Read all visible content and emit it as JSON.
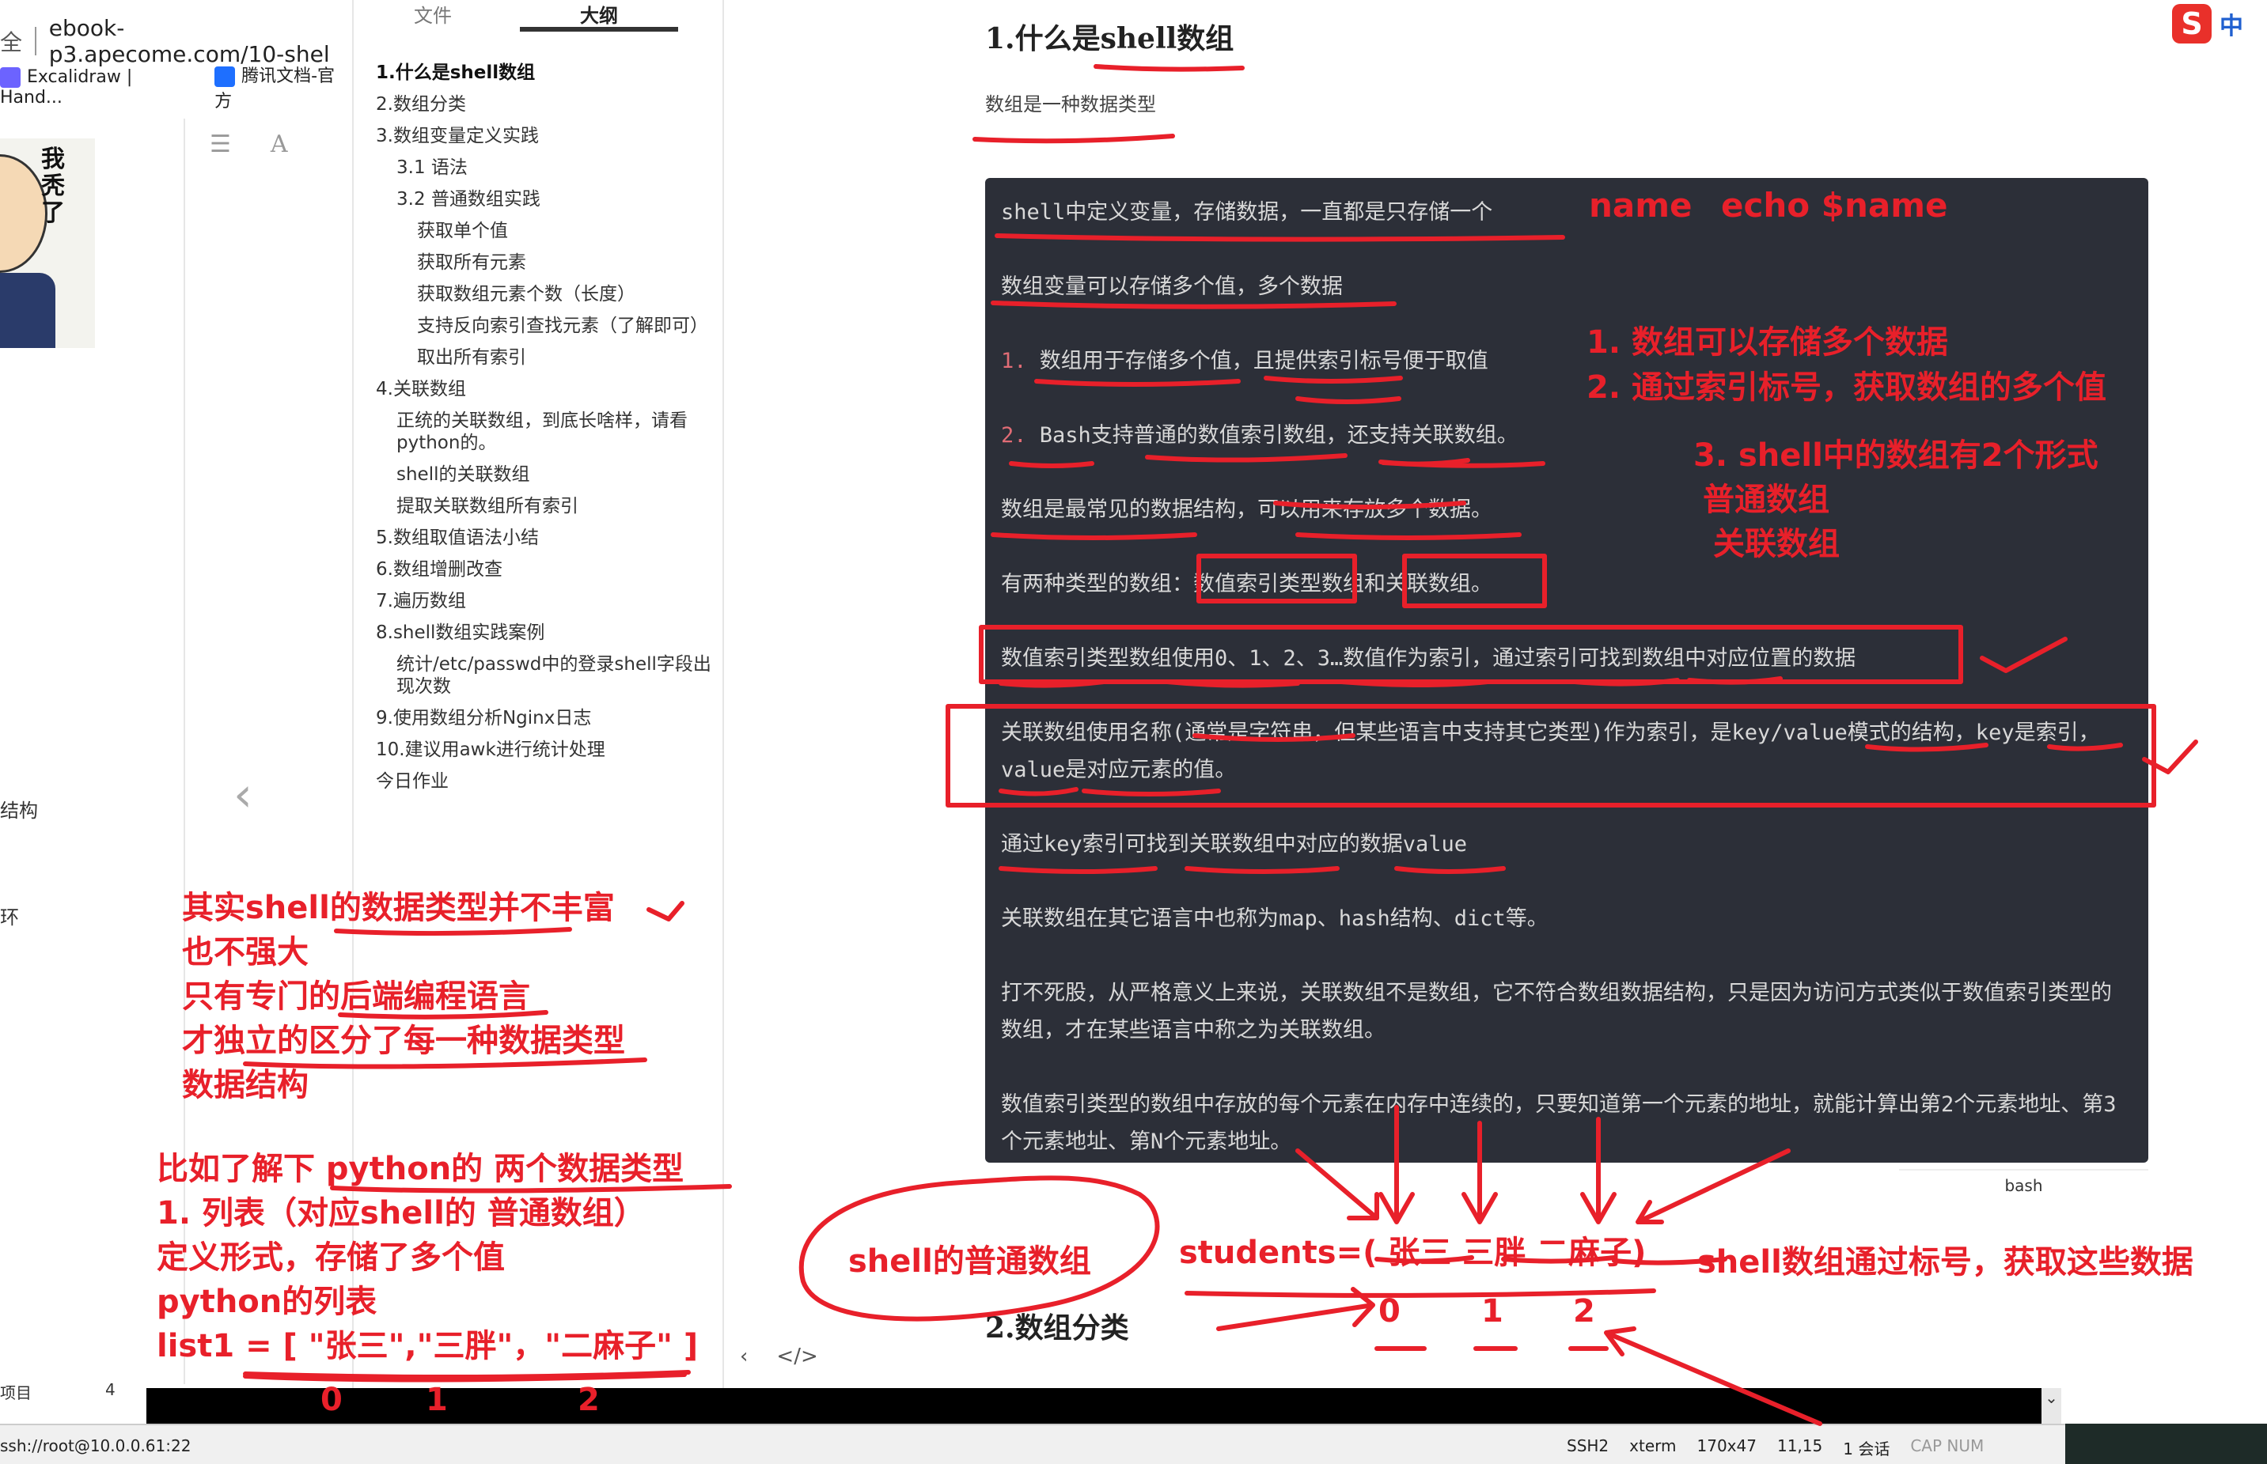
{
  "browser": {
    "security_label": "全",
    "url": "ebook-p3.apecome.com/10-shel",
    "bookmarks": [
      {
        "label": "Excalidraw | Hand...",
        "color": "#6c63ff"
      },
      {
        "label": "腾讯文档-官方",
        "color": "#1e6fff"
      }
    ],
    "avatar_caption": "我秃了",
    "side_words": [
      "结构",
      "环"
    ]
  },
  "outline": {
    "tabs": [
      "文件",
      "大纲"
    ],
    "items": [
      {
        "label": "1.什么是shell数组",
        "level": 1,
        "active": true
      },
      {
        "label": "2.数组分类",
        "level": 1
      },
      {
        "label": "3.数组变量定义实践",
        "level": 1
      },
      {
        "label": "3.1 语法",
        "level": 2
      },
      {
        "label": "3.2 普通数组实践",
        "level": 2
      },
      {
        "label": "获取单个值",
        "level": 3
      },
      {
        "label": "获取所有元素",
        "level": 3
      },
      {
        "label": "获取数组元素个数（长度）",
        "level": 3
      },
      {
        "label": "支持反向索引查找元素（了解即可）",
        "level": 3
      },
      {
        "label": "取出所有索引",
        "level": 3
      },
      {
        "label": "4.关联数组",
        "level": 1
      },
      {
        "label": "正统的关联数组，到底长啥样，请看python的。",
        "level": 2
      },
      {
        "label": "shell的关联数组",
        "level": 2
      },
      {
        "label": "提取关联数组所有索引",
        "level": 2
      },
      {
        "label": "5.数组取值语法小结",
        "level": 1
      },
      {
        "label": "6.数组增删改查",
        "level": 1
      },
      {
        "label": "7.遍历数组",
        "level": 1
      },
      {
        "label": "8.shell数组实践案例",
        "level": 1
      },
      {
        "label": "统计/etc/passwd中的登录shell字段出现次数",
        "level": 2
      },
      {
        "label": "9.使用数组分析Nginx日志",
        "level": 1
      },
      {
        "label": "10.建议用awk进行统计处理",
        "level": 1
      },
      {
        "label": "今日作业",
        "level": 1
      }
    ]
  },
  "doc": {
    "title_prefix": "1.什么是",
    "title_bold": "shell",
    "title_suffix": "数组",
    "subtitle": "数组是一种数据类型",
    "code_lines": [
      "shell中定义变量，存储数据，一直都是只存储一个",
      "数组变量可以存储多个值，多个数据",
      "1. 数组用于存储多个值，且提供索引标号便于取值",
      "2. Bash支持普通的数值索引数组，还支持关联数组。",
      "数组是最常见的数据结构，可以用来存放多个数据。",
      "有两种类型的数组：数值索引类型数组和关联数组。",
      "数值索引类型数组使用0、1、2、3…数值作为索引，通过索引可找到数组中对应位置的数据",
      "关联数组使用名称(通常是字符串，但某些语言中支持其它类型)作为索引，是key/value模式的结构，key是索引，value是对应元素的值。",
      "通过key索引可找到关联数组中对应的数据value",
      "关联数组在其它语言中也称为map、hash结构、dict等。",
      "打不死股，从严格意义上来说，关联数组不是数组，它不符合数组数据结构，只是因为访问方式类似于数值索引类型的数组，才在某些语言中称之为关联数组。",
      "数值索引类型的数组中存放的每个元素在内存中连续的，只要知道第一个元素的地址，就能计算出第2个元素地址、第3个元素地址、第N个元素地址。"
    ],
    "code_lang": "bash",
    "section2": "2.数组分类"
  },
  "ime": {
    "logo": "S",
    "mode": "中"
  },
  "terminal": {
    "left_label": "项目",
    "left_num": "4",
    "session": "ssh://root@10.0.0.61:22",
    "status_items": [
      "SSH2",
      "xterm",
      "170x47",
      "11,15",
      "1 会话",
      "CAP NUM"
    ]
  },
  "annotations": {
    "top_right": [
      "name",
      "echo $name"
    ],
    "summary": [
      "1. 数组可以存储多个数据",
      "2. 通过索引标号，获取数组的多个值",
      "3. shell中的数组有2个形式",
      "普通数组",
      "关联数组"
    ],
    "left_notes": [
      "其实shell的数据类型并不丰富",
      "也不强大",
      "只有专门的后端编程语言",
      "才独立的区分了每一种数据类型",
      "数据结构"
    ],
    "python_notes": [
      "比如了解下 python的 两个数据类型",
      "1. 列表（对应shell的 普通数组）",
      "定义形式，存储了多个值",
      "python的列表",
      "list1 = [ \"张三\",\"三胖\"，\"二麻子\" ]"
    ],
    "python_indexes": [
      "0",
      "1",
      "2"
    ],
    "shell_array_bubble": "shell的普通数组",
    "students_array": "students=( 张三 三胖  二麻子)",
    "students_indexes": [
      "0",
      "1",
      "2"
    ],
    "students_note": "shell数组通过标号，获取这些数据"
  }
}
